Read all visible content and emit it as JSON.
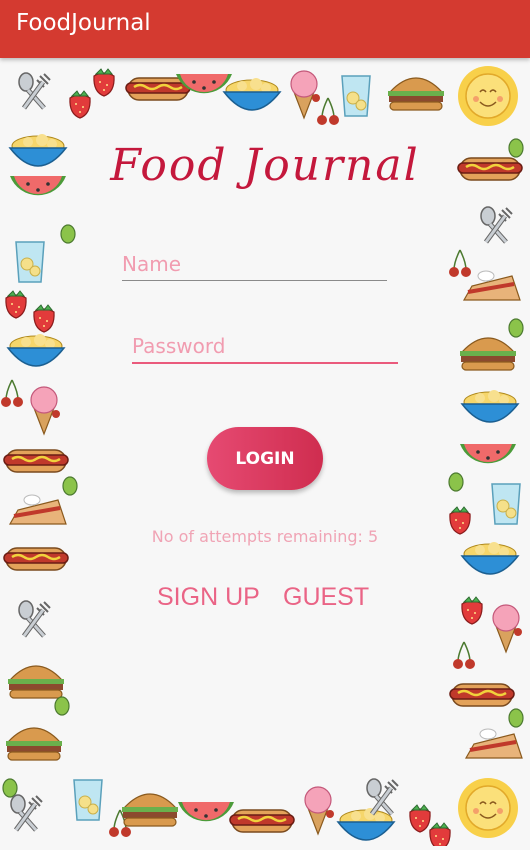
{
  "app_bar": {
    "title": "FoodJournal"
  },
  "form": {
    "title": "Food Journal",
    "name_placeholder": "Name",
    "password_placeholder": "Password",
    "login_label": "LOGIN",
    "attempts_text": "No of attempts remaining: 5",
    "signup_label": "SIGN UP",
    "guest_label": "GUEST"
  },
  "colors": {
    "app_bar": "#d43a30",
    "accent": "#e64a72",
    "title": "#c4183c",
    "link": "#ea6486"
  },
  "frame_icons": [
    "fork-spoon-icon",
    "strawberry-icon",
    "hotdog-icon",
    "watermelon-icon",
    "cereal-bowl-icon",
    "ice-cream-icon",
    "lemonade-glass-icon",
    "burger-icon",
    "sun-icon",
    "pie-icon",
    "cherry-icon",
    "pea-icon"
  ]
}
